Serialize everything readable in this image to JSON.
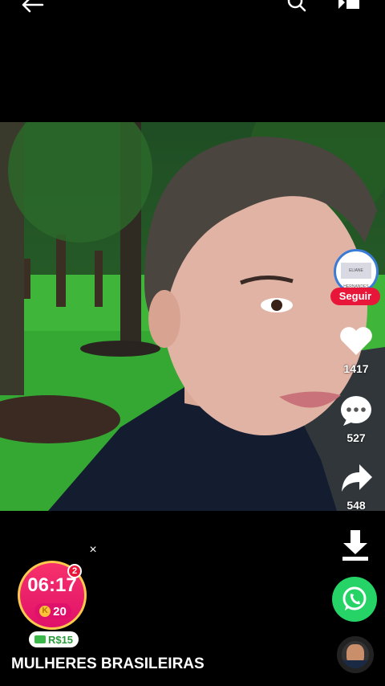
{
  "topbar": {
    "back_icon": "arrow-left-icon",
    "search_icon": "search-icon",
    "panel_icon": "panel-toggle-icon"
  },
  "video": {
    "description": "selfie video frame"
  },
  "creator": {
    "avatar_text": "ELIANE HERNANDES",
    "follow_label": "Seguir"
  },
  "actions": {
    "likes": "1417",
    "comments": "527",
    "shares": "548"
  },
  "reward_timer": {
    "time": "06:17",
    "coins": "20",
    "coin_symbol": "K",
    "badge": "2",
    "close": "×",
    "reward": "R$15"
  },
  "caption": "MULHERES BRASILEIRAS",
  "colors": {
    "follow": "#e8173a",
    "timer": "#f7316b",
    "whatsapp": "#25d366"
  }
}
